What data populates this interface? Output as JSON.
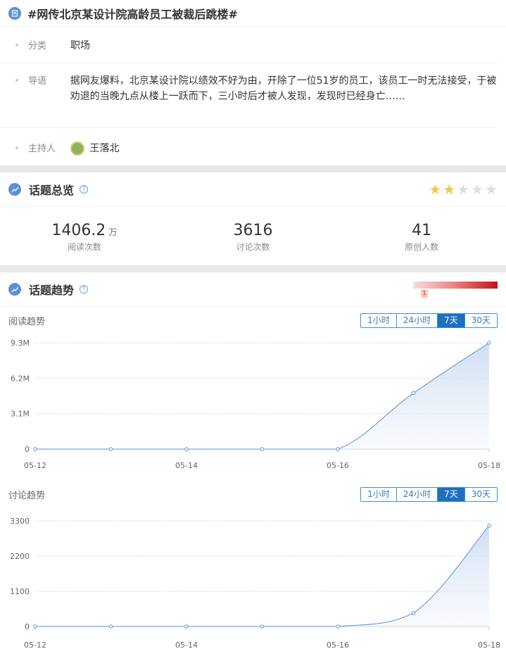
{
  "topic": {
    "title": "#网传北京某设计院高龄员工被裁后跳楼#"
  },
  "info": {
    "category_label": "分类",
    "category_value": "职场",
    "intro_label": "导语",
    "intro_value": "据网友爆料，北京某设计院以绩效不好为由，开除了一位51岁的员工，该员工一时无法接受，于被劝退的当晚九点从楼上一跃而下，三小时后才被人发现，发现时已经身亡……",
    "host_label": "主持人",
    "host_value": "王落北"
  },
  "overview": {
    "title": "话题总览",
    "help": "?",
    "rating": 2,
    "stats": [
      {
        "value": "1406.2",
        "unit": "万",
        "caption": "阅读次数"
      },
      {
        "value": "3616",
        "unit": "",
        "caption": "讨论次数"
      },
      {
        "value": "41",
        "unit": "",
        "caption": "原创人数"
      }
    ]
  },
  "trend": {
    "title": "话题趋势",
    "help": "?",
    "heat_marker": "1",
    "range_buttons": [
      "1小时",
      "24小时",
      "7天",
      "30天"
    ],
    "active_range": "7天"
  },
  "chart_data": [
    {
      "type": "area",
      "title": "阅读趋势",
      "x": [
        "05-12",
        "05-13",
        "05-14",
        "05-15",
        "05-16",
        "05-17",
        "05-18"
      ],
      "x_tick_labels": [
        "05-12",
        "05-14",
        "05-16",
        "05-18"
      ],
      "values": [
        0,
        0,
        0,
        0,
        0,
        4900000,
        9300000
      ],
      "yticks": [
        0,
        3100000,
        6200000,
        9300000
      ],
      "ytick_labels": [
        "0",
        "3.1M",
        "6.2M",
        "9.3M"
      ],
      "ylim": [
        0,
        9300000
      ],
      "grid": true,
      "color": "#5b8fd9"
    },
    {
      "type": "area",
      "title": "讨论趋势",
      "x": [
        "05-12",
        "05-13",
        "05-14",
        "05-15",
        "05-16",
        "05-17",
        "05-18"
      ],
      "x_tick_labels": [
        "05-12",
        "05-14",
        "05-16",
        "05-18"
      ],
      "values": [
        0,
        0,
        0,
        0,
        0,
        420,
        3150
      ],
      "yticks": [
        0,
        1100,
        2200,
        3300
      ],
      "ytick_labels": [
        "0",
        "1100",
        "2200",
        "3300"
      ],
      "ylim": [
        0,
        3300
      ],
      "grid": true,
      "color": "#5b8fd9"
    }
  ]
}
